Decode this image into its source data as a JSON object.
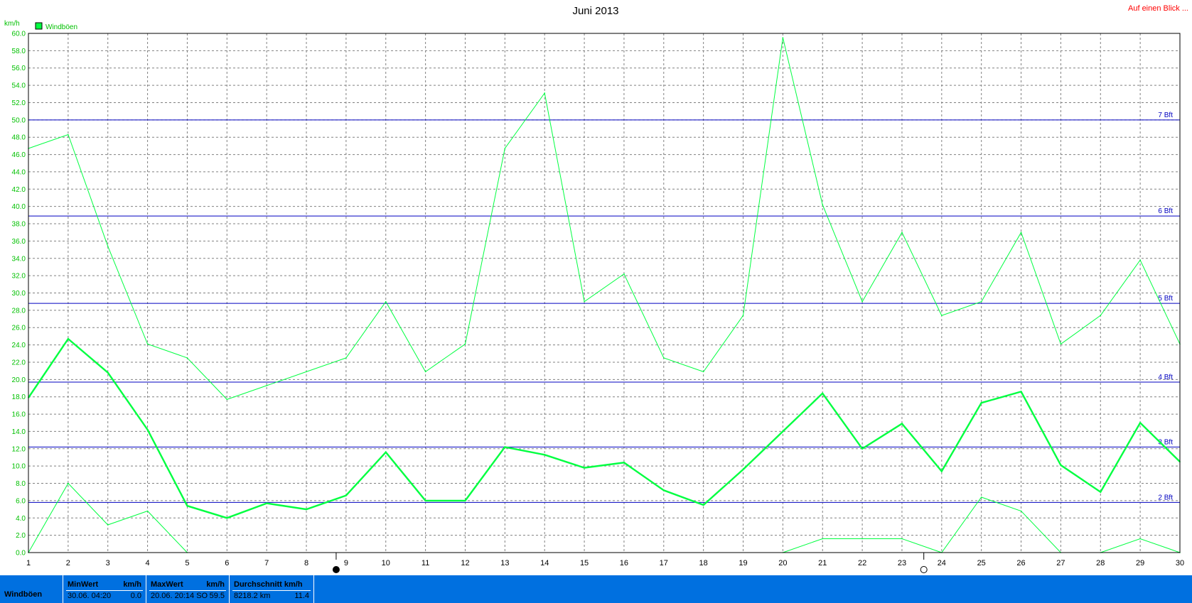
{
  "header": {
    "title": "Juni 2013",
    "top_link": "Auf einen Blick ..."
  },
  "colors": {
    "series": "#00ff40",
    "reference_line": "#0000c0",
    "grid": "#808080",
    "status_bar": "#0070e0"
  },
  "chart_data": {
    "type": "line",
    "title": "Juni 2013",
    "ylabel": "km/h",
    "xlabel": "",
    "ylim": [
      0,
      60
    ],
    "ytick_step": 2,
    "x": [
      1,
      2,
      3,
      4,
      5,
      6,
      7,
      8,
      9,
      10,
      11,
      12,
      13,
      14,
      15,
      16,
      17,
      18,
      19,
      20,
      21,
      22,
      23,
      24,
      25,
      26,
      27,
      28,
      29,
      30
    ],
    "grid": true,
    "legend": {
      "position": "top-left",
      "entries": [
        "Windböen"
      ]
    },
    "series": [
      {
        "name": "Windböen",
        "role": "max",
        "values": [
          46.7,
          48.3,
          35.4,
          24.1,
          22.5,
          17.7,
          19.3,
          20.9,
          22.5,
          29.0,
          20.9,
          24.1,
          46.7,
          53.1,
          29.0,
          32.2,
          22.5,
          20.9,
          27.4,
          59.5,
          40.2,
          29.0,
          37.0,
          27.4,
          29.0,
          37.0,
          24.1,
          27.4,
          33.8,
          24.1
        ]
      },
      {
        "name": "Windböen",
        "role": "mean",
        "values": [
          17.9,
          24.7,
          20.8,
          14.2,
          5.4,
          4.0,
          5.7,
          5.0,
          6.6,
          11.6,
          6.0,
          6.0,
          12.2,
          11.3,
          9.8,
          10.4,
          7.2,
          5.5,
          9.6,
          14.0,
          18.4,
          12.0,
          14.9,
          9.4,
          17.3,
          18.6,
          10.1,
          7.0,
          15.0,
          10.5
        ]
      },
      {
        "name": "Windböen",
        "role": "min",
        "values": [
          0.0,
          8.0,
          3.2,
          4.8,
          0.0,
          null,
          null,
          null,
          null,
          null,
          null,
          null,
          null,
          null,
          null,
          null,
          null,
          null,
          null,
          0.0,
          1.6,
          1.6,
          1.6,
          0.0,
          6.4,
          4.8,
          0.0,
          0.0,
          1.6,
          0.0
        ]
      }
    ],
    "reference_lines": [
      {
        "label": "2 Bft",
        "value": 5.8
      },
      {
        "label": "3 Bft",
        "value": 12.2
      },
      {
        "label": "4 Bft",
        "value": 19.7
      },
      {
        "label": "5 Bft",
        "value": 28.8
      },
      {
        "label": "6 Bft",
        "value": 38.9
      },
      {
        "label": "7 Bft",
        "value": 50.0
      }
    ],
    "moon_phases": [
      {
        "day": 8.75,
        "phase": "new-moon"
      },
      {
        "day": 23.55,
        "phase": "full-moon"
      }
    ]
  },
  "status_bar": {
    "series_name": "Windböen",
    "min": {
      "head": "MinWert",
      "unit": "km/h",
      "time": "30.06.  04:20",
      "value": "0.0"
    },
    "max": {
      "head": "MaxWert",
      "unit": "km/h",
      "time": "20.06.  20:14 SO",
      "value": "59.5"
    },
    "avg": {
      "head": "Durchschnitt km/h",
      "dist": "8218.2 km",
      "value": "11.4"
    }
  }
}
